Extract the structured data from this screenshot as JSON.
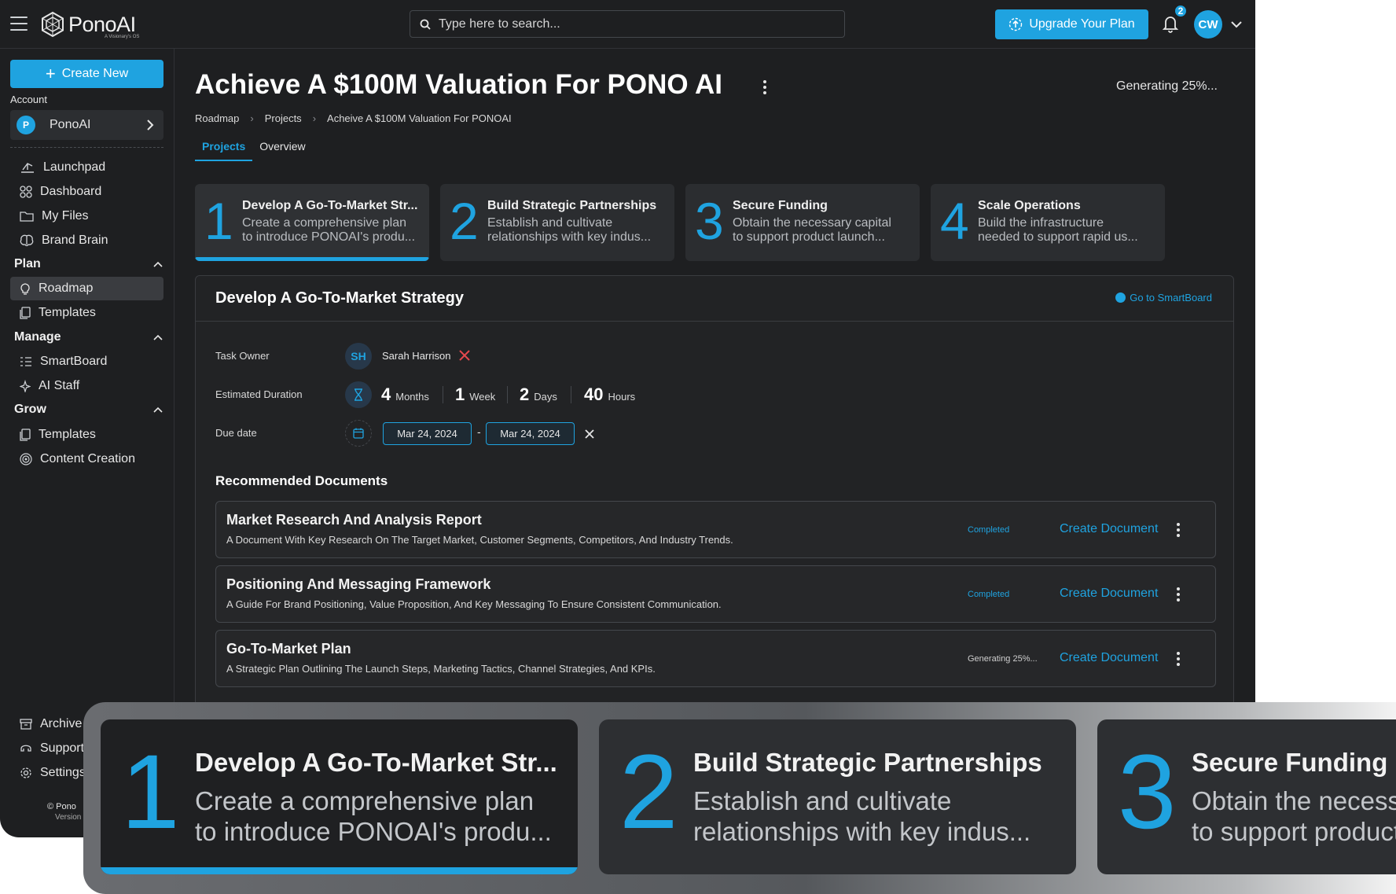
{
  "topbar": {
    "logo_text": "PonoAI",
    "logo_sub": "A Visionary's OS",
    "search_placeholder": "Type here to search...",
    "upgrade_label": "Upgrade Your Plan",
    "notification_count": "2",
    "avatar_initials": "CW"
  },
  "sidebar": {
    "create_label": "Create New",
    "account_label": "Account",
    "account_name": "PonoAI",
    "account_initial": "P",
    "items": [
      {
        "label": "Launchpad"
      },
      {
        "label": "Dashboard"
      },
      {
        "label": "My Files"
      },
      {
        "label": "Brand Brain"
      }
    ],
    "sections": {
      "plan": "Plan",
      "manage": "Manage",
      "grow": "Grow"
    },
    "plan_items": [
      {
        "label": "Roadmap"
      },
      {
        "label": "Templates"
      }
    ],
    "manage_items": [
      {
        "label": "SmartBoard"
      },
      {
        "label": "AI Staff"
      }
    ],
    "grow_items": [
      {
        "label": "Templates"
      },
      {
        "label": "Content Creation"
      }
    ],
    "bottom_items": [
      {
        "label": "Archive"
      },
      {
        "label": "Support"
      },
      {
        "label": "Settings"
      }
    ],
    "copyright": "© Pono",
    "version": "Version"
  },
  "main": {
    "title": "Achieve A $100M Valuation For PONO AI",
    "generating": "Generating 25%...",
    "breadcrumb": [
      "Roadmap",
      "Projects",
      "Acheive A $100M Valuation For PONOAI"
    ],
    "tabs": [
      {
        "label": "Projects"
      },
      {
        "label": "Overview"
      }
    ],
    "steps": [
      {
        "num": "1",
        "title": "Develop A Go-To-Market Str...",
        "desc1": "Create a comprehensive plan",
        "desc2": "to introduce PONOAI's produ..."
      },
      {
        "num": "2",
        "title": "Build Strategic Partnerships",
        "desc1": "Establish and cultivate",
        "desc2": "relationships with key indus..."
      },
      {
        "num": "3",
        "title": "Secure Funding",
        "desc1": "Obtain the necessary capital",
        "desc2": "to support product launch..."
      },
      {
        "num": "4",
        "title": "Scale Operations",
        "desc1": "Build the infrastructure",
        "desc2": "needed to support rapid us..."
      }
    ],
    "panel": {
      "title": "Develop A Go-To-Market Strategy",
      "smartboard_link": "Go to SmartBoard",
      "owner_label": "Task Owner",
      "owner_initials": "SH",
      "owner_name": "Sarah Harrison",
      "duration_label": "Estimated Duration",
      "duration": [
        {
          "n": "4",
          "u": "Months"
        },
        {
          "n": "1",
          "u": "Week"
        },
        {
          "n": "2",
          "u": "Days"
        },
        {
          "n": "40",
          "u": "Hours"
        }
      ],
      "due_label": "Due date",
      "due_start": "Mar 24, 2024",
      "due_end": "Mar 24, 2024",
      "date_separator": "-",
      "recommended_title": "Recommended Documents",
      "documents": [
        {
          "title": "Market Research And Analysis Report",
          "desc": "A Document With Key Research On The Target Market, Customer Segments, Competitors, And Industry Trends.",
          "status": "Completed",
          "action": "Create Document"
        },
        {
          "title": "Positioning And Messaging Framework",
          "desc": "A Guide For Brand Positioning, Value Proposition, And Key Messaging To Ensure Consistent Communication.",
          "status": "Completed",
          "action": "Create Document"
        },
        {
          "title": "Go-To-Market Plan",
          "desc": "A Strategic Plan Outlining The Launch Steps, Marketing Tactics, Channel Strategies, And KPIs.",
          "status": "Generating 25%...",
          "action": "Create Document"
        }
      ]
    }
  },
  "colors": {
    "accent": "#1fa3e0",
    "background": "#1e1f21",
    "card": "#2b2d30"
  }
}
